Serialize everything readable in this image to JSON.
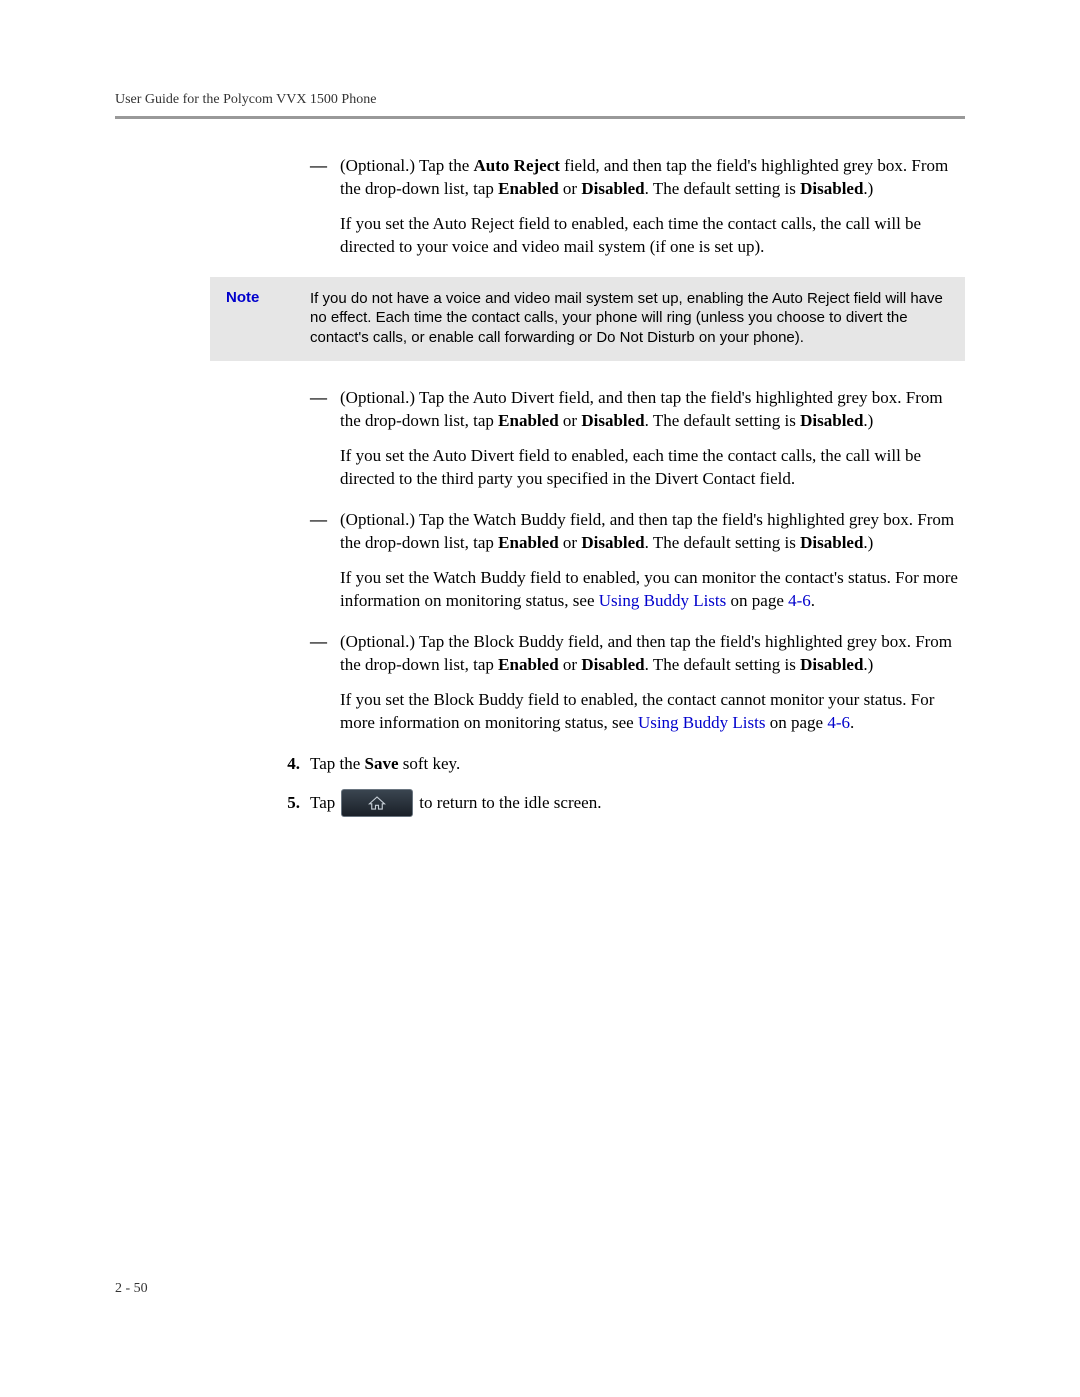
{
  "header": "User Guide for the Polycom VVX 1500 Phone",
  "item1": {
    "prefix": "(Optional.) Tap the ",
    "bold1": "Auto Reject",
    "mid1": " field, and then tap the field's highlighted grey box. From the drop-down list, tap ",
    "bold2": "Enabled",
    "mid2": " or ",
    "bold3": "Disabled",
    "mid3": ". The default setting is ",
    "bold4": "Disabled",
    "end": ".)",
    "para": "If you set the Auto Reject field to enabled, each time the contact calls, the call will be directed to your voice and video mail system (if one is set up)."
  },
  "note": {
    "label": "Note",
    "text": "If you do not have a voice and video mail system set up, enabling the Auto Reject field will have no effect. Each time the contact calls, your phone will ring (unless you choose to divert the contact's calls, or enable call forwarding or Do Not Disturb on your phone)."
  },
  "item2": {
    "prefix": "(Optional.) Tap the Auto Divert field, and then tap the field's highlighted grey box. From the drop-down list, tap ",
    "bold1": "Enabled",
    "mid1": " or ",
    "bold2": "Disabled",
    "mid2": ". The default setting is ",
    "bold3": "Disabled",
    "end": ".)",
    "para": "If you set the Auto Divert field to enabled, each time the contact calls, the call will be directed to the third party you specified in the Divert Contact field."
  },
  "item3": {
    "prefix": "(Optional.) Tap the Watch Buddy field, and then tap the field's highlighted grey box. From the drop-down list, tap ",
    "bold1": "Enabled",
    "mid1": " or ",
    "bold2": "Disabled",
    "mid2": ". The default setting is ",
    "bold3": "Disabled",
    "end": ".)",
    "para_prefix": "If you set the Watch Buddy field to enabled, you can monitor the contact's status. For more information on monitoring status, see ",
    "link": "Using Buddy Lists",
    "para_suffix": " on page ",
    "pageref": "4-6",
    "para_end": "."
  },
  "item4": {
    "prefix": "(Optional.) Tap the Block Buddy field, and then tap the field's highlighted grey box. From the drop-down list, tap ",
    "bold1": "Enabled",
    "mid1": " or ",
    "bold2": "Disabled",
    "mid2": ". The default setting is ",
    "bold3": "Disabled",
    "end": ".)",
    "para_prefix": "If you set the Block Buddy field to enabled, the contact cannot monitor your status. For more information on monitoring status, see ",
    "link": "Using Buddy Lists",
    "para_suffix": " on page ",
    "pageref": "4-6",
    "para_end": "."
  },
  "step4": {
    "num": "4.",
    "prefix": "Tap the ",
    "bold": "Save",
    "suffix": " soft key."
  },
  "step5": {
    "num": "5.",
    "prefix": "Tap ",
    "suffix": " to return to the idle screen."
  },
  "dash": "—",
  "pagenum": "2 - 50"
}
